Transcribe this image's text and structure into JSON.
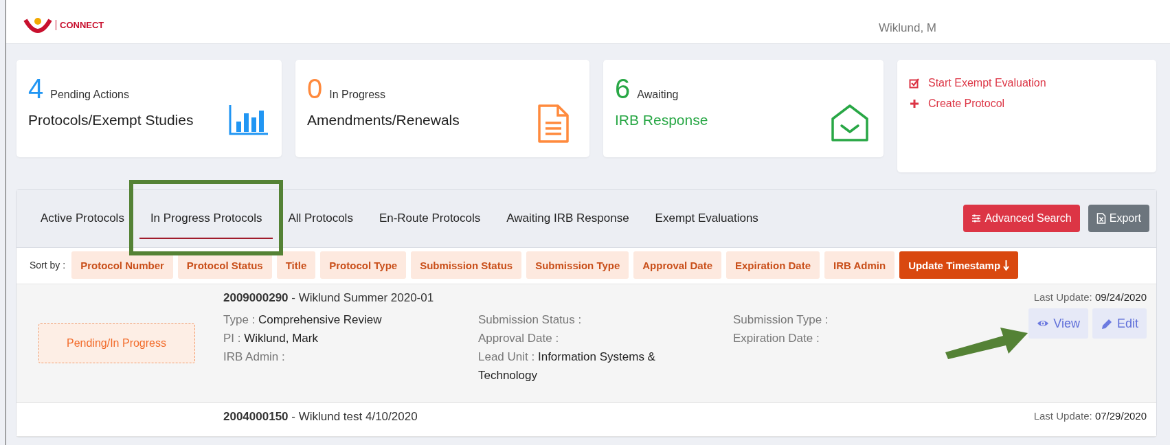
{
  "header": {
    "logo_text": "CONNECT",
    "user": "Wiklund, M"
  },
  "summary_cards": [
    {
      "count": "4",
      "count_label": "Pending Actions",
      "title": "Protocols/Exempt Studies",
      "color": "#2196f3",
      "kind": "chart"
    },
    {
      "count": "0",
      "count_label": "In Progress",
      "title": "Amendments/Renewals",
      "color": "#ff8a3d",
      "kind": "document"
    },
    {
      "count": "6",
      "count_label": "Awaiting",
      "title": "IRB Response",
      "color": "#28a745",
      "kind": "envelope"
    }
  ],
  "quick_actions": [
    {
      "label": "Start Exempt Evaluation",
      "kind": "checkbox"
    },
    {
      "label": "Create Protocol",
      "kind": "plus"
    }
  ],
  "tabs": [
    {
      "label": "Active Protocols",
      "selected": false,
      "highlighted": false
    },
    {
      "label": "In Progress Protocols",
      "selected": true,
      "highlighted": true
    },
    {
      "label": "All Protocols",
      "selected": false,
      "highlighted": false
    },
    {
      "label": "En-Route Protocols",
      "selected": false,
      "highlighted": false
    },
    {
      "label": "Awaiting IRB Response",
      "selected": false,
      "highlighted": false
    },
    {
      "label": "Exempt Evaluations",
      "selected": false,
      "highlighted": false
    }
  ],
  "toolbar_buttons": [
    {
      "label": "Advanced Search",
      "kind": "search"
    },
    {
      "label": "Export",
      "kind": "export"
    }
  ],
  "sort": {
    "label": "Sort by :",
    "options": [
      {
        "label": "Protocol Number",
        "selected": false
      },
      {
        "label": "Protocol Status",
        "selected": false
      },
      {
        "label": "Title",
        "selected": false
      },
      {
        "label": "Protocol Type",
        "selected": false
      },
      {
        "label": "Submission Status",
        "selected": false
      },
      {
        "label": "Submission Type",
        "selected": false
      },
      {
        "label": "Approval Date",
        "selected": false
      },
      {
        "label": "Expiration Date",
        "selected": false
      },
      {
        "label": "IRB Admin",
        "selected": false
      },
      {
        "label": "Update Timestamp",
        "selected": true
      }
    ]
  },
  "records": [
    {
      "number": "2009000290",
      "title": " - Wiklund Summer 2020-01",
      "status": "Pending/In Progress",
      "columns": [
        [
          {
            "label": "Type :",
            "value": "Comprehensive Review"
          },
          {
            "label": "PI :",
            "value": "Wiklund, Mark"
          },
          {
            "label": "IRB Admin :"
          }
        ],
        [
          {
            "label": "Submission Status :"
          },
          {
            "label": "Approval Date :"
          },
          {
            "label": "Lead Unit :",
            "value": "Information Systems & Technology"
          }
        ],
        [
          {
            "label": "Submission Type :"
          },
          {
            "label": "Expiration Date :"
          }
        ]
      ],
      "last_update_label": "Last Update:",
      "last_update": "09/24/2020",
      "actions": [
        {
          "label": "View",
          "kind": "view",
          "pointed": true
        },
        {
          "label": "Edit",
          "kind": "edit",
          "pointed": false
        }
      ]
    },
    {
      "number": "2004000150",
      "title": " - Wiklund test 4/10/2020",
      "last_update_label": "Last Update:",
      "last_update": "07/29/2020"
    }
  ]
}
